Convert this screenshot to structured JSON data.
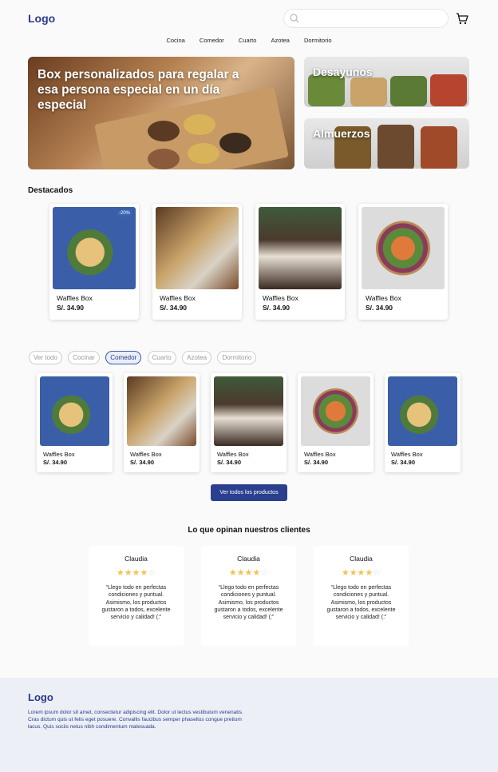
{
  "header": {
    "logo": "Logo",
    "search_placeholder": ""
  },
  "nav": [
    "Cocina",
    "Comedor",
    "Cuarto",
    "Azotea",
    "Dormitorio"
  ],
  "hero": {
    "title": "Box personalizados para regalar a esa persona especial en un día especial"
  },
  "side_cards": [
    {
      "title": "Desayunos"
    },
    {
      "title": "Almuerzos"
    }
  ],
  "featured": {
    "title": "Destacados",
    "products": [
      {
        "name": "Waffles Box",
        "price": "S/. 34.90",
        "badge": "-20%",
        "image": "salad-bowl-blue"
      },
      {
        "name": "Waffles Box",
        "price": "S/. 34.90",
        "badge": "",
        "image": "salad-jar"
      },
      {
        "name": "Waffles Box",
        "price": "S/. 34.90",
        "badge": "",
        "image": "chocolate-dessert"
      },
      {
        "name": "Waffles Box",
        "price": "S/. 34.90",
        "badge": "",
        "image": "salmon-bowl"
      }
    ]
  },
  "filters": {
    "chips": [
      "Ver todo",
      "Cocinar",
      "Comedor",
      "Cuarto",
      "Azotea",
      "Dormitorio"
    ],
    "active": "Comedor"
  },
  "grid": {
    "products": [
      {
        "name": "Waffles Box",
        "price": "S/. 34.90",
        "image": "salad-bowl-blue"
      },
      {
        "name": "Waffles Box",
        "price": "S/. 34.90",
        "image": "salad-jar"
      },
      {
        "name": "Waffles Box",
        "price": "S/. 34.90",
        "image": "chocolate-dessert"
      },
      {
        "name": "Waffles Box",
        "price": "S/. 34.90",
        "image": "salmon-bowl"
      },
      {
        "name": "Waffles Box",
        "price": "S/. 34.90",
        "image": "salad-bowl-blue"
      }
    ],
    "button_label": "Ver todos los productos"
  },
  "reviews": {
    "title": "Lo que opinan nuestros clientes",
    "items": [
      {
        "name": "Claudia",
        "rating": 4,
        "text": "“Llego todo en perfectas condiciones y puntual. Asimismo, los productos gustaron a todos, excelente servicio y calidad! (:”"
      },
      {
        "name": "Claudia",
        "rating": 4,
        "text": "“Llego todo en perfectas condiciones y puntual. Asimismo, los productos gustaron a todos, excelente servicio y calidad! (:”"
      },
      {
        "name": "Claudia",
        "rating": 4,
        "text": "“Llego todo en perfectas condiciones y puntual. Asimismo, los productos gustaron a todos, excelente servicio y calidad! (:”"
      }
    ]
  },
  "footer": {
    "logo": "Logo",
    "text": "Lorem ipsum dolor sit amet, consectetur adipiscing elit. Dolor ut lectus vestibulum venenatis. Cras dictum quis ut felis eget posuere. Convallis faucibus semper phasellus congue pretium lacus. Quis sociis netus nibh condimentum malesuada."
  },
  "colors": {
    "brand": "#2b3a8c",
    "star": "#f5c24b",
    "chip_active_bg": "#e9eef9"
  }
}
